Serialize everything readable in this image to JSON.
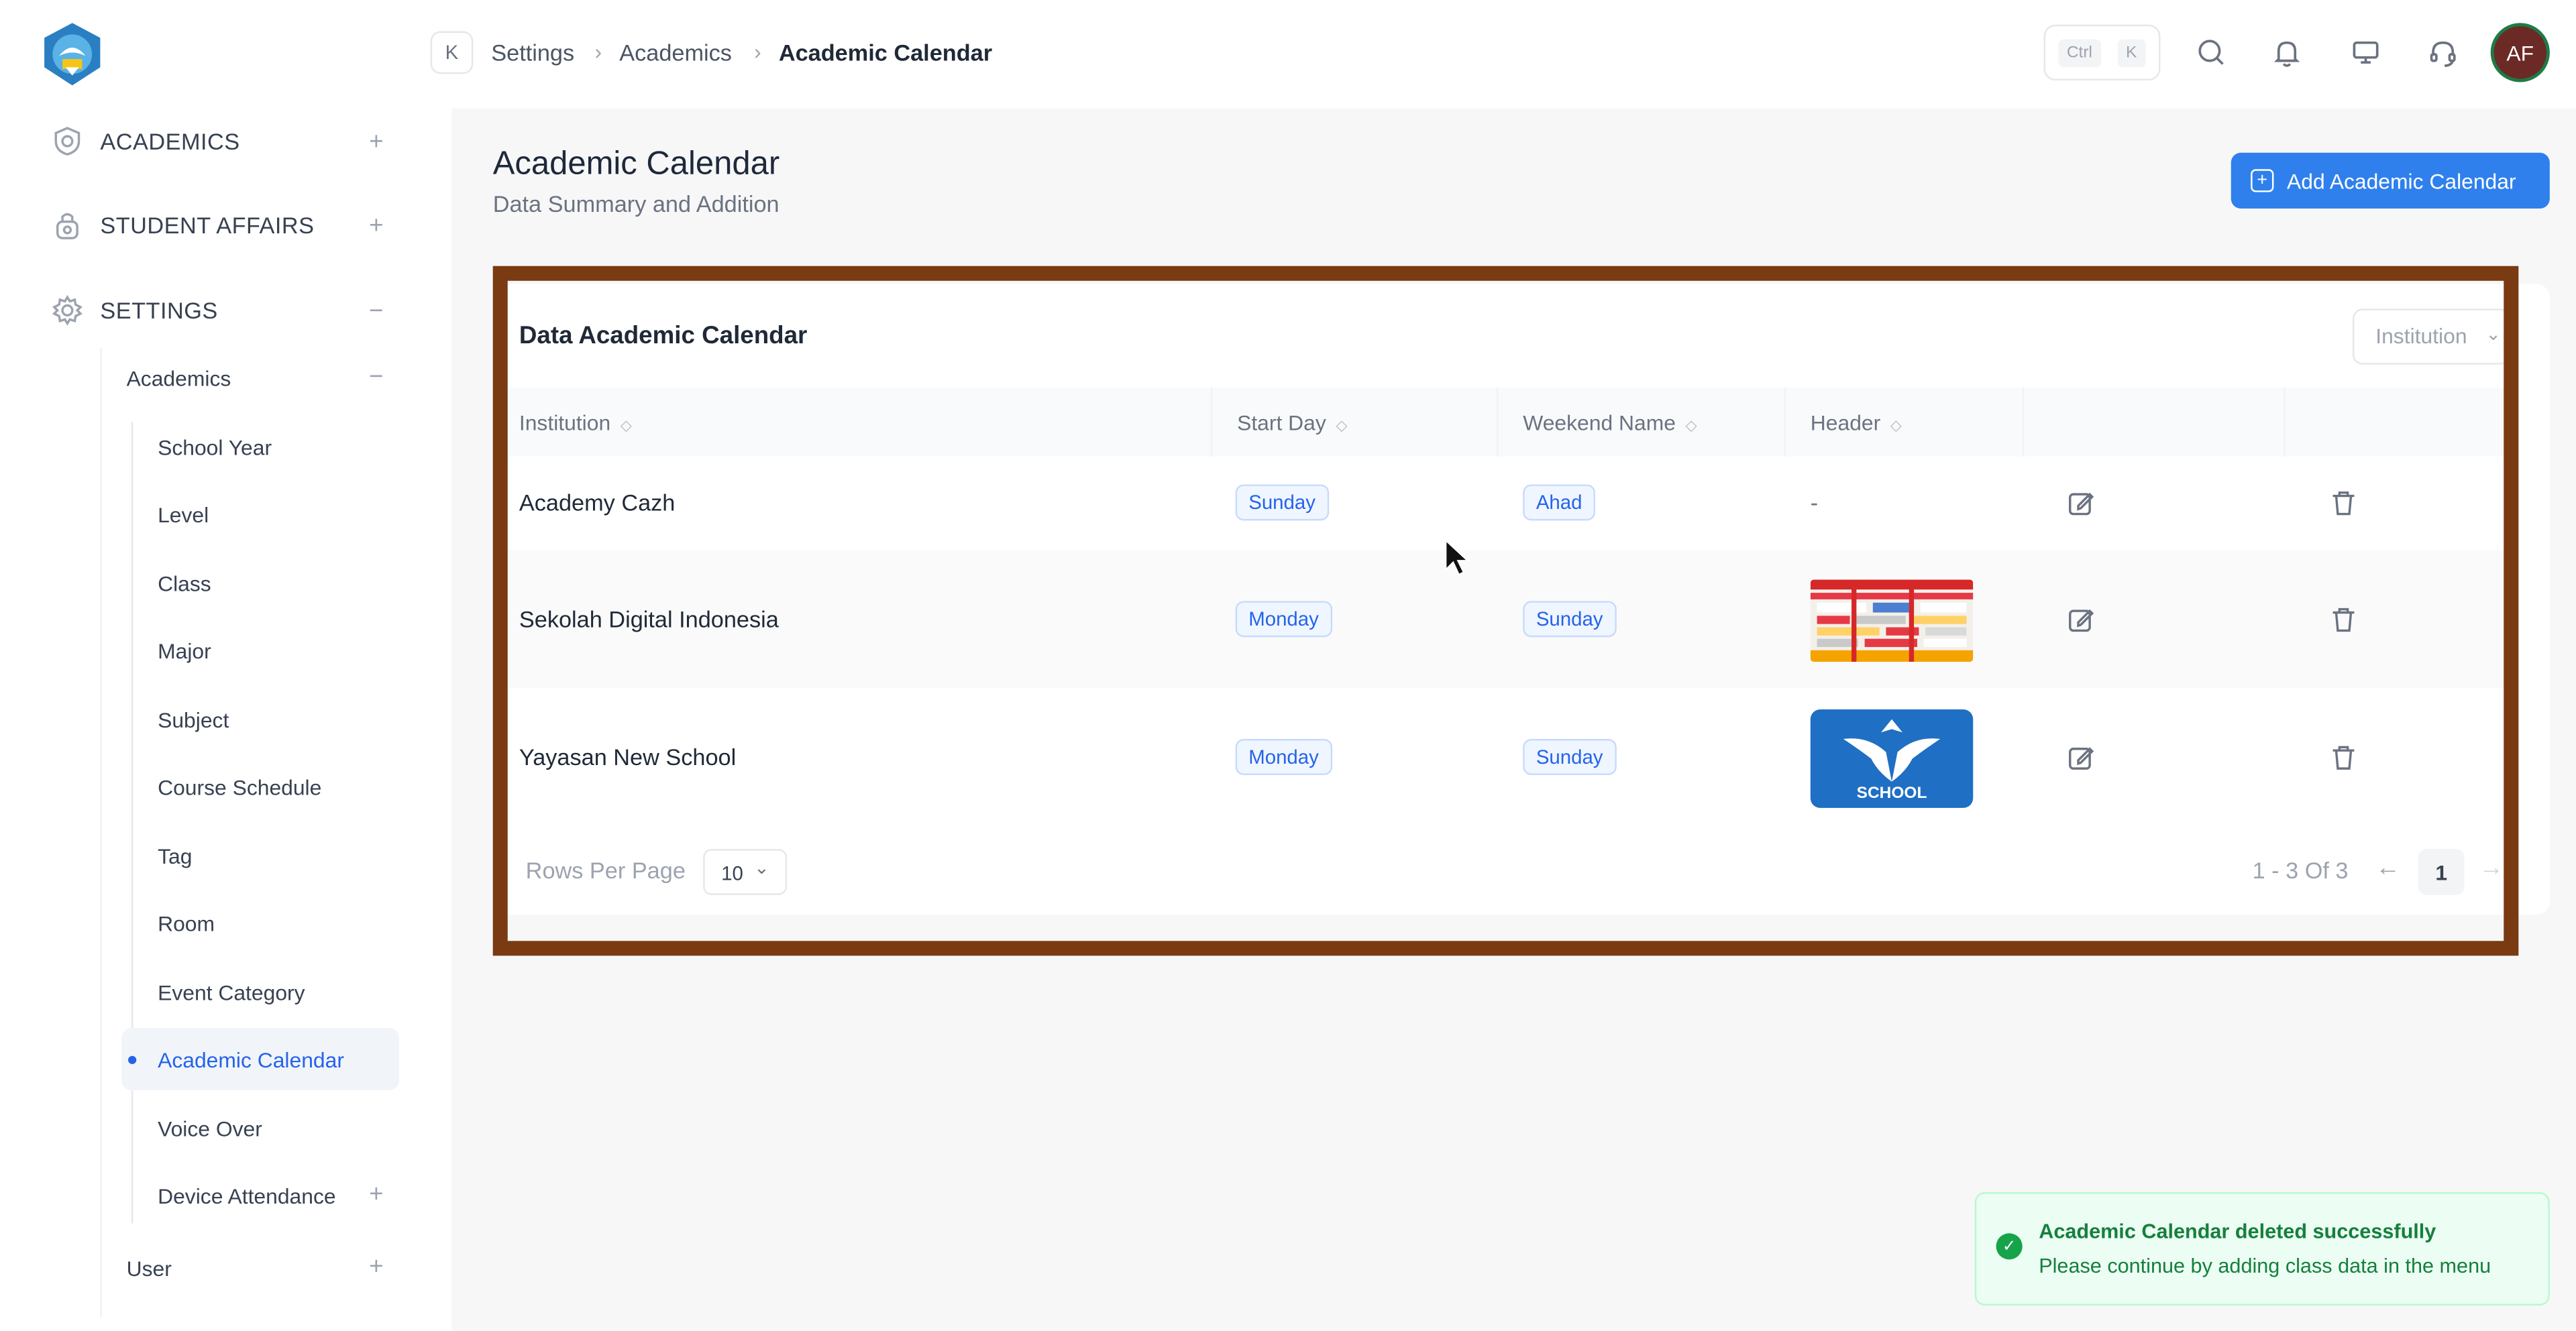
{
  "sidebar": {
    "sections": [
      {
        "label": "ACADEMICS",
        "toggle": "+"
      },
      {
        "label": "STUDENT AFFAIRS",
        "toggle": "+"
      },
      {
        "label": "SETTINGS",
        "toggle": "−"
      }
    ],
    "sub_academics": {
      "label": "Academics",
      "toggle": "−"
    },
    "items": [
      "School Year",
      "Level",
      "Class",
      "Major",
      "Subject",
      "Course Schedule",
      "Tag",
      "Room",
      "Event Category",
      "Academic Calendar",
      "Voice Over",
      "Device Attendance"
    ],
    "device_attendance_toggle": "+",
    "user": {
      "label": "User",
      "toggle": "+"
    },
    "active_item": "Academic Calendar",
    "accent_color": "#2563eb"
  },
  "topbar": {
    "collapse_icon": "K",
    "breadcrumb": [
      "Settings",
      "Academics",
      "Academic Calendar"
    ],
    "breadcrumb_sep": "›",
    "shortcut": {
      "ctrl": "Ctrl",
      "key": "K"
    },
    "icons": [
      "search-icon",
      "bell-icon",
      "monitor-icon",
      "headset-icon"
    ],
    "avatar_initials": "AF"
  },
  "page": {
    "title": "Academic Calendar",
    "subtitle": "Data Summary and Addition",
    "add_button_label": "Add Academic Calendar",
    "add_button_color": "#2f80ed"
  },
  "table": {
    "title": "Data Academic Calendar",
    "filter_placeholder": "Institution",
    "columns": [
      "Institution",
      "Start Day",
      "Weekend Name",
      "Header"
    ],
    "sort_glyph": "◇",
    "rows": [
      {
        "institution": "Academy Cazh",
        "start_day": "Sunday",
        "weekend_name": "Ahad",
        "header": "-"
      },
      {
        "institution": "Sekolah Digital Indonesia",
        "start_day": "Monday",
        "weekend_name": "Sunday",
        "header": ""
      },
      {
        "institution": "Yayasan New School",
        "start_day": "Monday",
        "weekend_name": "Sunday",
        "header": ""
      }
    ],
    "thumb_school_text": "SCHOOL",
    "rows_per_page_label": "Rows Per Page",
    "rows_per_page_value": "10",
    "page_info": "1 - 3 Of 3",
    "current_page": "1",
    "prev_arrow": "←",
    "next_arrow": "→"
  },
  "toast": {
    "title": "Academic Calendar deleted successfully",
    "message": "Please continue by adding class data in the menu",
    "color": "#15803d"
  },
  "highlight_frame_color": "#7a3a12"
}
